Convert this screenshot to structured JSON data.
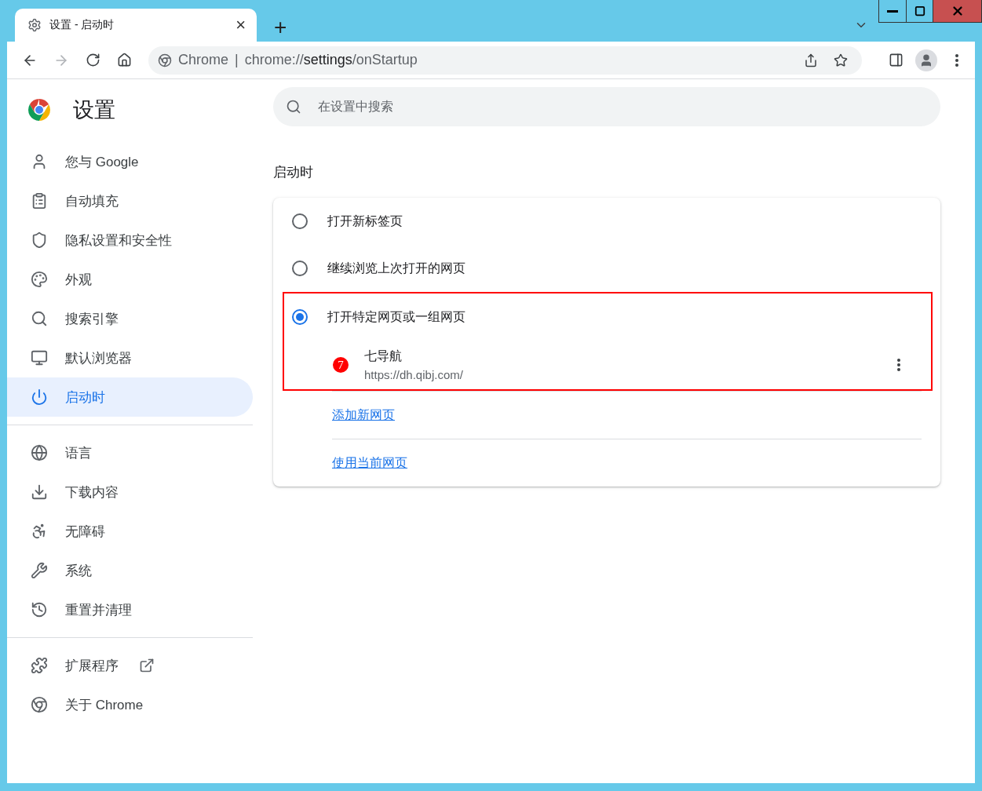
{
  "tab": {
    "title": "设置 - 启动时",
    "close": "×",
    "new_tab": "+"
  },
  "address_bar": {
    "site_label": "Chrome",
    "separator": "|",
    "url_scheme": "chrome://",
    "url_host": "settings",
    "url_path": "/onStartup"
  },
  "header": {
    "title": "设置",
    "search_placeholder": "在设置中搜索"
  },
  "sidebar": {
    "sections": [
      [
        {
          "label": "您与 Google",
          "selected": false
        },
        {
          "label": "自动填充",
          "selected": false
        },
        {
          "label": "隐私设置和安全性",
          "selected": false
        },
        {
          "label": "外观",
          "selected": false
        },
        {
          "label": "搜索引擎",
          "selected": false
        },
        {
          "label": "默认浏览器",
          "selected": false
        },
        {
          "label": "启动时",
          "selected": true
        }
      ],
      [
        {
          "label": "语言",
          "selected": false
        },
        {
          "label": "下载内容",
          "selected": false
        },
        {
          "label": "无障碍",
          "selected": false
        },
        {
          "label": "系统",
          "selected": false
        },
        {
          "label": "重置并清理",
          "selected": false
        }
      ],
      [
        {
          "label": "扩展程序",
          "selected": false,
          "external": true
        },
        {
          "label": "关于 Chrome",
          "selected": false
        }
      ]
    ]
  },
  "section": {
    "title": "启动时",
    "options": [
      {
        "label": "打开新标签页",
        "selected": false
      },
      {
        "label": "继续浏览上次打开的网页",
        "selected": false
      },
      {
        "label": "打开特定网页或一组网页",
        "selected": true
      }
    ],
    "pages": [
      {
        "favicon": "7",
        "title": "七导航",
        "url": "https://dh.qibj.com/"
      }
    ],
    "links": [
      "添加新网页",
      "使用当前网页"
    ]
  }
}
